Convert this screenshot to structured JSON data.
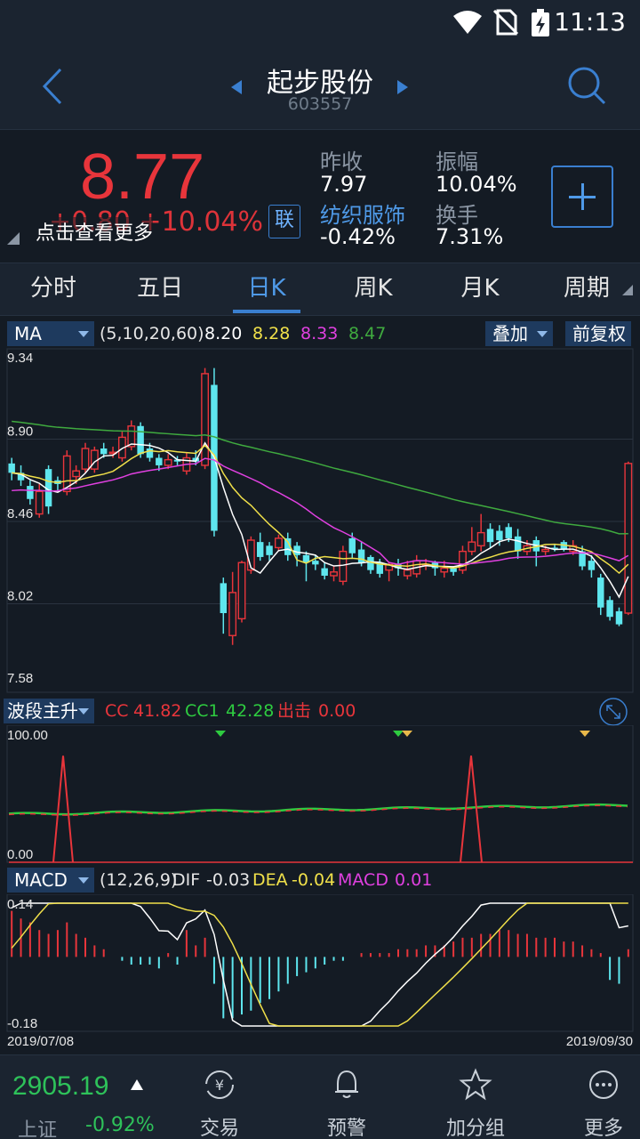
{
  "status_bar": {
    "time": "11:13"
  },
  "header": {
    "stock_name": "起步股份",
    "stock_code": "603557"
  },
  "quote": {
    "price": "8.77",
    "change": "+0.80  +10.04%",
    "tip": "点击查看更多",
    "link_label": "联",
    "prev_close_label": "昨收",
    "prev_close": "7.97",
    "amplitude_label": "振幅",
    "amplitude": "10.04%",
    "sector": "纺织服饰",
    "sector_change": "-0.42%",
    "turnover_label": "换手",
    "turnover": "7.31%"
  },
  "tabs": [
    "分时",
    "五日",
    "日K",
    "周K",
    "月K",
    "周期"
  ],
  "active_tab": "日K",
  "ma_bar": {
    "selector": "MA",
    "params": "(5,10,20,60)",
    "ma5": "8.20",
    "ma10": "8.28",
    "ma20": "8.33",
    "ma60": "8.47",
    "overlay": "叠加",
    "adjust": "前复权"
  },
  "kline_axis": [
    "9.34",
    "8.90",
    "8.46",
    "8.02",
    "7.58"
  ],
  "cc_bar": {
    "selector": "波段主升",
    "cc_label": "CC",
    "cc": "41.82",
    "cc1_label": "CC1",
    "cc1": "42.28",
    "out_label": "出击",
    "out": "0.00"
  },
  "cc_axis": [
    "100.00",
    "0.00"
  ],
  "macd_bar": {
    "selector": "MACD",
    "params": "(12,26,9)",
    "dif_label": "DIF",
    "dif": "-0.03",
    "dea_label": "DEA",
    "dea": "-0.04",
    "macd_label": "MACD",
    "macd": "0.01"
  },
  "macd_axis": [
    "0.14",
    "-0.18"
  ],
  "dates": {
    "start": "2019/07/08",
    "end": "2019/09/30"
  },
  "colors": {
    "up": "#e8353b",
    "down": "#5ee6ee",
    "ma5": "#ffffff",
    "ma10": "#f0e04a",
    "ma20": "#e040e0",
    "ma60": "#3faa3f",
    "accent": "#3a7fd0"
  },
  "index": {
    "value": "2905.19",
    "name": "上证",
    "change": "-0.92%"
  },
  "nav": [
    {
      "label": "交易",
      "icon": "trade-icon"
    },
    {
      "label": "预警",
      "icon": "bell-icon"
    },
    {
      "label": "加分组",
      "icon": "star-icon"
    },
    {
      "label": "更多",
      "icon": "more-icon"
    }
  ],
  "candles": [
    [
      8.77,
      8.72,
      8.8,
      8.68
    ],
    [
      8.72,
      8.68,
      8.76,
      8.65
    ],
    [
      8.65,
      8.58,
      8.68,
      8.55
    ],
    [
      8.5,
      8.62,
      8.66,
      8.48
    ],
    [
      8.74,
      8.54,
      8.76,
      8.5
    ],
    [
      8.68,
      8.66,
      8.7,
      8.62
    ],
    [
      8.62,
      8.81,
      8.84,
      8.6
    ],
    [
      8.7,
      8.73,
      8.76,
      8.66
    ],
    [
      8.74,
      8.85,
      8.88,
      8.72
    ],
    [
      8.74,
      8.84,
      8.86,
      8.72
    ],
    [
      8.85,
      8.82,
      8.88,
      8.8
    ],
    [
      8.83,
      8.83,
      8.86,
      8.8
    ],
    [
      8.8,
      8.91,
      8.94,
      8.78
    ],
    [
      8.86,
      8.97,
      9.0,
      8.84
    ],
    [
      8.97,
      8.82,
      8.99,
      8.8
    ],
    [
      8.85,
      8.8,
      8.88,
      8.78
    ],
    [
      8.8,
      8.76,
      8.82,
      8.73
    ],
    [
      8.76,
      8.79,
      8.82,
      8.74
    ],
    [
      8.79,
      8.78,
      8.81,
      8.76
    ],
    [
      8.73,
      8.8,
      8.83,
      8.71
    ],
    [
      8.8,
      8.78,
      8.84,
      8.76
    ],
    [
      8.76,
      9.25,
      9.28,
      8.74
    ],
    [
      9.19,
      8.41,
      9.28,
      8.38
    ],
    [
      8.13,
      7.97,
      8.16,
      7.86
    ],
    [
      7.85,
      8.08,
      8.19,
      7.8
    ],
    [
      7.94,
      8.24,
      8.25,
      7.92
    ],
    [
      8.2,
      8.36,
      8.38,
      8.18
    ],
    [
      8.35,
      8.27,
      8.4,
      8.25
    ],
    [
      8.33,
      8.28,
      8.35,
      8.25
    ],
    [
      8.32,
      8.37,
      8.39,
      8.3
    ],
    [
      8.37,
      8.28,
      8.4,
      8.25
    ],
    [
      8.33,
      8.28,
      8.35,
      8.22
    ],
    [
      8.28,
      8.24,
      8.3,
      8.14
    ],
    [
      8.25,
      8.23,
      8.28,
      8.2
    ],
    [
      8.21,
      8.17,
      8.24,
      8.15
    ],
    [
      8.17,
      8.19,
      8.22,
      8.14
    ],
    [
      8.14,
      8.3,
      8.33,
      8.12
    ],
    [
      8.37,
      8.29,
      8.4,
      8.26
    ],
    [
      8.31,
      8.24,
      8.35,
      8.22
    ],
    [
      8.27,
      8.2,
      8.28,
      8.18
    ],
    [
      8.24,
      8.18,
      8.26,
      8.16
    ],
    [
      8.2,
      8.23,
      8.24,
      8.14
    ],
    [
      8.23,
      8.21,
      8.26,
      8.17
    ],
    [
      8.17,
      8.2,
      8.25,
      8.15
    ],
    [
      8.18,
      8.25,
      8.28,
      8.16
    ],
    [
      8.23,
      8.23,
      8.26,
      8.2
    ],
    [
      8.24,
      8.21,
      8.25,
      8.17
    ],
    [
      8.19,
      8.21,
      8.25,
      8.16
    ],
    [
      8.21,
      8.19,
      8.22,
      8.17
    ],
    [
      8.2,
      8.3,
      8.33,
      8.18
    ],
    [
      8.3,
      8.35,
      8.43,
      8.28
    ],
    [
      8.33,
      8.4,
      8.5,
      8.3
    ],
    [
      8.42,
      8.35,
      8.45,
      8.32
    ],
    [
      8.41,
      8.36,
      8.44,
      8.33
    ],
    [
      8.43,
      8.37,
      8.45,
      8.35
    ],
    [
      8.38,
      8.3,
      8.42,
      8.26
    ],
    [
      8.3,
      8.33,
      8.36,
      8.28
    ],
    [
      8.36,
      8.3,
      8.38,
      8.22
    ],
    [
      8.3,
      8.31,
      8.33,
      8.28
    ],
    [
      8.32,
      8.31,
      8.34,
      8.3
    ],
    [
      8.35,
      8.31,
      8.36,
      8.3
    ],
    [
      8.3,
      8.33,
      8.36,
      8.28
    ],
    [
      8.3,
      8.22,
      8.33,
      8.2
    ],
    [
      8.25,
      8.2,
      8.28,
      8.16
    ],
    [
      8.16,
      8.0,
      8.18,
      7.96
    ],
    [
      8.04,
      7.95,
      8.06,
      7.93
    ],
    [
      7.98,
      7.91,
      8.0,
      7.9
    ],
    [
      7.97,
      8.77,
      8.78,
      7.96
    ]
  ],
  "macd_hist": [
    0.12,
    0.1,
    0.09,
    0.07,
    0.06,
    0.07,
    0.09,
    0.06,
    0.05,
    0.03,
    0.02,
    0.0,
    -0.01,
    -0.02,
    -0.02,
    -0.02,
    -0.03,
    0.01,
    -0.02,
    0.07,
    0.03,
    0.05,
    -0.07,
    -0.16,
    -0.16,
    -0.15,
    -0.14,
    -0.12,
    -0.11,
    -0.09,
    -0.07,
    -0.05,
    -0.04,
    -0.03,
    -0.02,
    -0.01,
    -0.01,
    0.0,
    0.01,
    0.01,
    0.01,
    0.01,
    0.02,
    0.02,
    0.02,
    0.03,
    0.03,
    0.03,
    0.04,
    0.05,
    0.05,
    0.06,
    0.06,
    0.07,
    0.07,
    0.06,
    0.06,
    0.05,
    0.05,
    0.05,
    0.04,
    0.04,
    0.03,
    0.02,
    0.01,
    -0.06,
    -0.07,
    0.02
  ]
}
